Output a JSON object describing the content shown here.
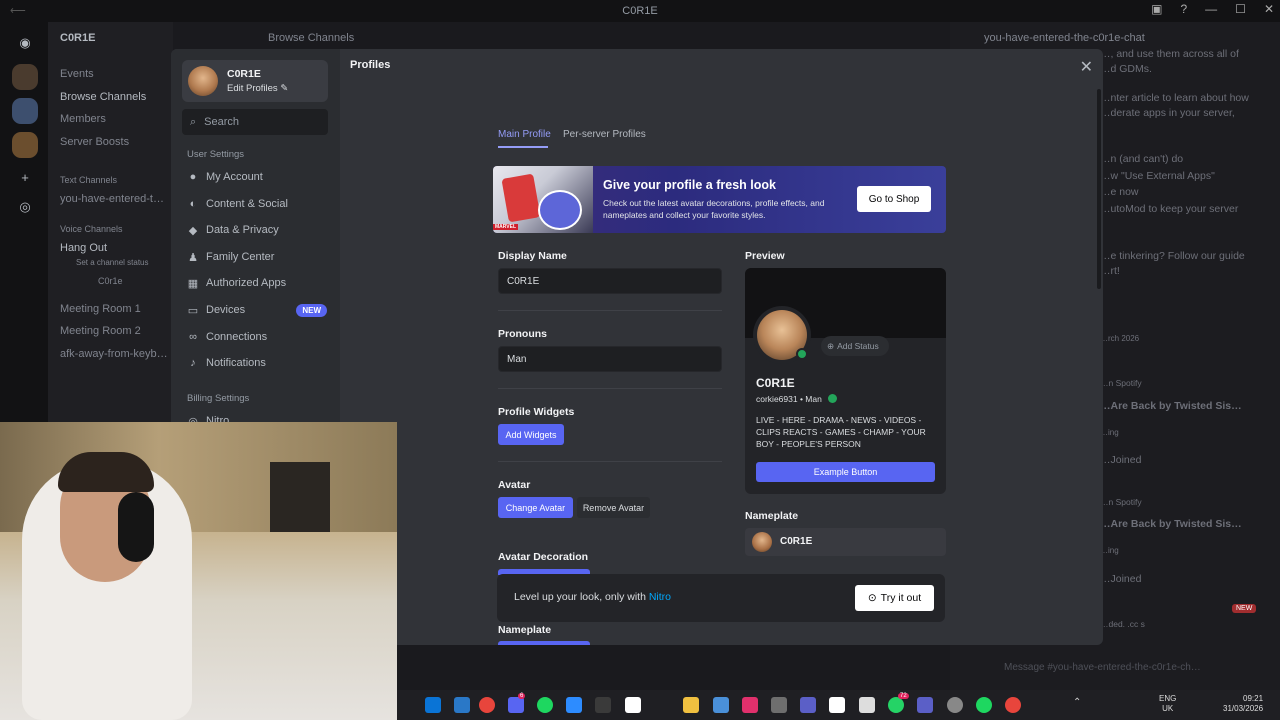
{
  "window": {
    "title": "C0R1E"
  },
  "server": {
    "name": "C0R1E",
    "browse_channels": "Browse Channels"
  },
  "channels": {
    "events": "Events",
    "browse": "Browse Channels",
    "members": "Members",
    "boosts": "Server Boosts",
    "text_header": "Text Channels",
    "text_channel": "you-have-entered-t…",
    "voice_header": "Voice Channels",
    "hang_out": "Hang Out",
    "hang_out_status": "Set a channel status",
    "hang_out_user": "C0r1e",
    "meeting1": "Meeting Room 1",
    "meeting2": "Meeting Room 2",
    "afk": "afk-away-from-keyb…"
  },
  "chat": {
    "channel_name": "you-have-entered-the-c0r1e-chat",
    "lines": [
      "…, and use them across all of",
      "…d GDMs.",
      "…nter article to learn about how",
      "…derate apps in your server,",
      "…n (and can't) do",
      "…w \"Use External Apps\"",
      "…e now",
      "…utoMod to keep your server",
      "…e tinkering? Follow our guide",
      "…rt!",
      "…rch 2026",
      "…n Spotify",
      "…Are Back by Twisted Sis…",
      "…ing",
      "…Joined",
      "…n Spotify",
      "…Are Back by Twisted Sis…",
      "…ing",
      "…Joined",
      "…ded. .cc s"
    ],
    "new_badge": "NEW",
    "input_placeholder": "Message #you-have-entered-the-c0r1e-ch…"
  },
  "settings": {
    "user": {
      "name": "C0R1E",
      "edit": "Edit Profiles"
    },
    "search_placeholder": "Search",
    "user_settings_header": "User Settings",
    "nav": [
      {
        "label": "My Account",
        "icon": "person-icon"
      },
      {
        "label": "Content & Social",
        "icon": "content-icon"
      },
      {
        "label": "Data & Privacy",
        "icon": "shield-icon"
      },
      {
        "label": "Family Center",
        "icon": "family-icon"
      },
      {
        "label": "Authorized Apps",
        "icon": "apps-icon"
      },
      {
        "label": "Devices",
        "icon": "devices-icon",
        "badge": "NEW"
      },
      {
        "label": "Connections",
        "icon": "link-icon"
      },
      {
        "label": "Notifications",
        "icon": "bell-icon"
      }
    ],
    "billing_header": "Billing Settings",
    "billing_first": "Nitro"
  },
  "profiles": {
    "title": "Profiles",
    "tabs": [
      "Main Profile",
      "Per-server Profiles"
    ],
    "banner": {
      "title": "Give your profile a fresh look",
      "text": "Check out the latest avatar decorations, profile effects, and nameplates and collect your favorite styles.",
      "button": "Go to Shop",
      "brand": "MARVEL"
    },
    "display_name_label": "Display Name",
    "display_name_value": "C0R1E",
    "pronouns_label": "Pronouns",
    "pronouns_value": "Man",
    "widgets_label": "Profile Widgets",
    "widgets_button": "Add Widgets",
    "avatar_label": "Avatar",
    "change_avatar": "Change Avatar",
    "remove_avatar": "Remove Avatar",
    "decoration_label": "Avatar Decoration",
    "nameplate_label": "Nameplate",
    "preview": {
      "label": "Preview",
      "add_status": "Add Status",
      "name": "C0R1E",
      "handle": "corkie6931 • Man",
      "bio": "LIVE - HERE - DRAMA - NEWS - VIDEOS - CLIPS REACTS - GAMES - CHAMP - YOUR BOY - PEOPLE'S PERSON",
      "button": "Example Button",
      "nameplate_label": "Nameplate",
      "nameplate_name": "C0R1E"
    },
    "nitro": {
      "text": "Level up your look, only with ",
      "link": "Nitro",
      "button": "Try it out"
    }
  },
  "taskbar": {
    "lang": "ENG",
    "region": "UK",
    "time": "09:21",
    "date": "31/03/2026",
    "discord_badge": "6",
    "whatsapp_badge": "72"
  },
  "colors": {
    "blurple": "#5865f2",
    "online": "#23a55a"
  }
}
